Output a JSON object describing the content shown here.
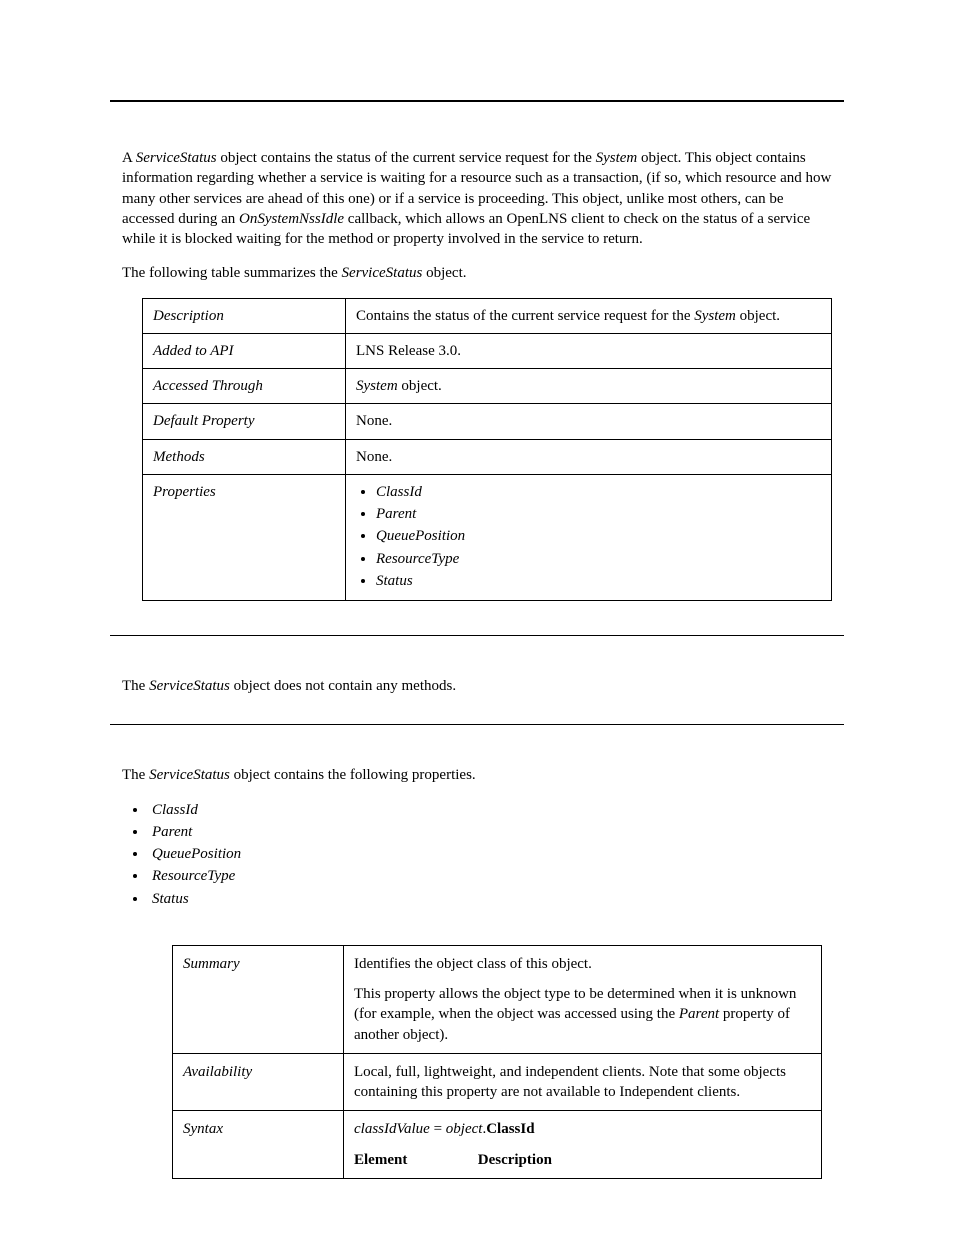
{
  "intro": {
    "pre1": "A ",
    "obj1": "ServiceStatus",
    "mid1": " object contains the status of the current service request for the ",
    "sys1": "System",
    "post1": " object.  This object contains information regarding whether a service is waiting for a resource such as a transaction, (if so, which resource and how many other services are ahead of this one) or if a service is proceeding. This object, unlike most others, can be accessed during an ",
    "cb": "OnSystemNssIdle",
    "post2": " callback, which allows an OpenLNS client to check on the status of a service while it is blocked waiting for the method or property involved in the service to return."
  },
  "follow": {
    "pre": "The following table summarizes the ",
    "obj": "ServiceStatus",
    "post": " object."
  },
  "summary": {
    "description": {
      "label": "Description",
      "pre": "Contains the status of the current service request for the ",
      "sys": "System",
      "post": " object."
    },
    "added": {
      "label": "Added to API",
      "value": "LNS Release 3.0."
    },
    "accessed": {
      "label": "Accessed Through",
      "pre": "",
      "sys": "System",
      "post": " object."
    },
    "default": {
      "label": "Default Property",
      "value": "None."
    },
    "methods": {
      "label": "Methods",
      "value": "None."
    },
    "properties": {
      "label": "Properties",
      "items": [
        "ClassId",
        "Parent",
        "QueuePosition",
        "ResourceType",
        "Status"
      ]
    }
  },
  "methods_sentence": {
    "pre": "The ",
    "obj": "ServiceStatus",
    "post": " object does not contain any methods."
  },
  "props_sentence": {
    "pre": "The ",
    "obj": "ServiceStatus",
    "post": " object contains the following properties."
  },
  "props_list": [
    "ClassId",
    "Parent",
    "QueuePosition",
    "ResourceType",
    "Status"
  ],
  "classid": {
    "summary": {
      "label": "Summary",
      "line1": "Identifies the object class of this object.",
      "line2_pre": "This property allows the object type to be determined when it is unknown (for example, when the object was accessed using the ",
      "line2_it": "Parent",
      "line2_post": " property of another object)."
    },
    "availability": {
      "label": "Availability",
      "value": "Local, full, lightweight, and independent clients. Note that some objects containing this property are not available to Independent clients."
    },
    "syntax": {
      "label": "Syntax",
      "lhs": "classIdValue",
      "eq": " = ",
      "obj": "object",
      "dot": ".",
      "prop": "ClassId",
      "h1": "Element",
      "h2": "Description"
    }
  }
}
